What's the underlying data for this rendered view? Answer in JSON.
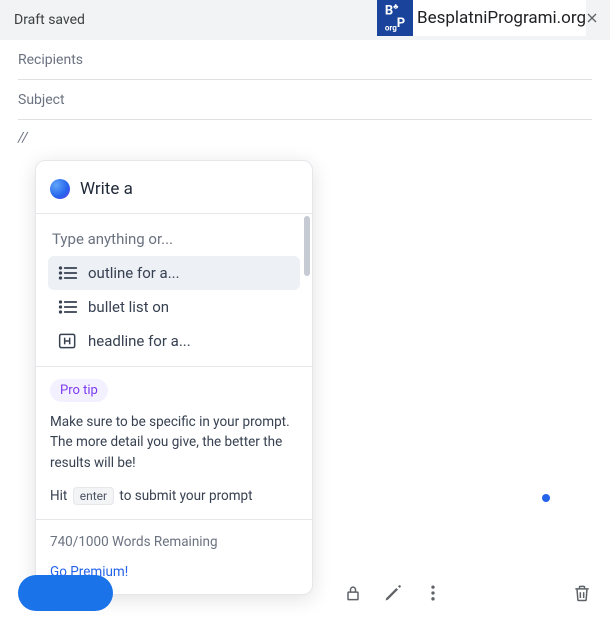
{
  "watermark": {
    "badge": "B\nP",
    "text": "BesplatniProgrami.org"
  },
  "header": {
    "status": "Draft saved"
  },
  "fields": {
    "recipients": "Recipients",
    "subject": "Subject"
  },
  "body": {
    "prefix": "//"
  },
  "popup": {
    "title": "Write a",
    "type_hint": "Type anything or...",
    "suggestions": [
      {
        "label": "outline for a..."
      },
      {
        "label": "bullet list on"
      },
      {
        "label": "headline for a..."
      }
    ],
    "protip": {
      "badge": "Pro tip",
      "text": "Make sure to be specific in your prompt. The more detail you give, the better the results will be!",
      "hit_pre": "Hit",
      "hit_key": "enter",
      "hit_post": "to submit your prompt"
    },
    "footer": {
      "words_remaining": "740/1000 Words Remaining",
      "premium": "Go Premium!"
    }
  }
}
